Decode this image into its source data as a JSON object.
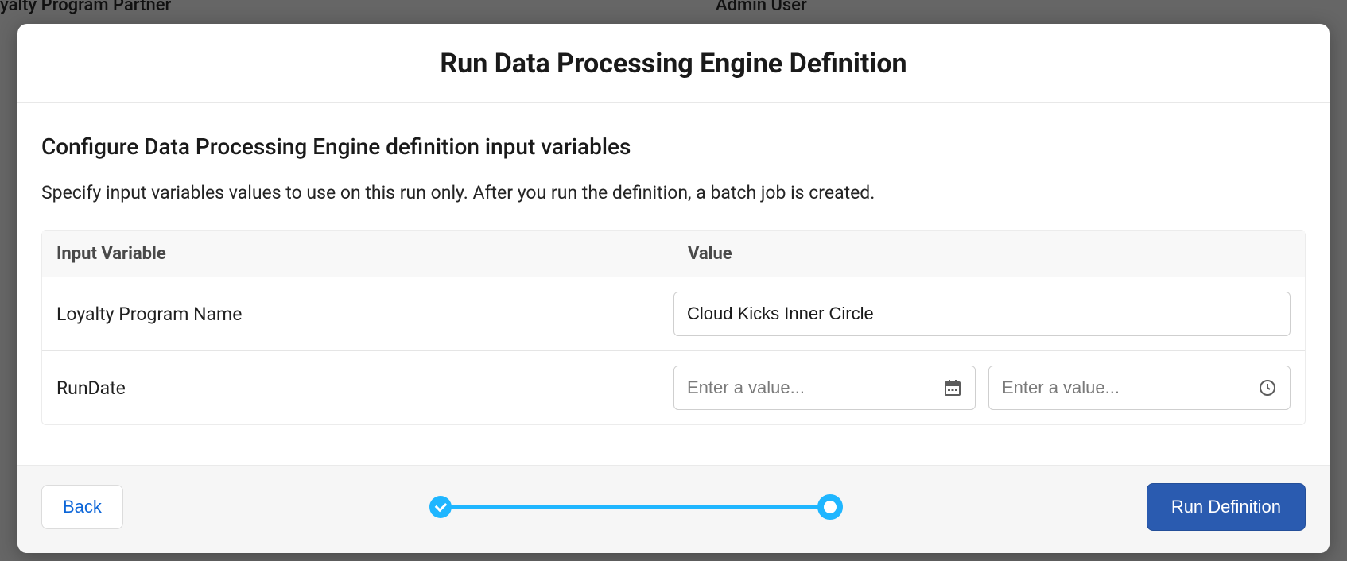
{
  "background": {
    "title_fragment": "yalty Program Partner",
    "user_label": "Admin User"
  },
  "modal": {
    "title": "Run Data Processing Engine Definition",
    "subtitle": "Configure Data Processing Engine definition input variables",
    "description": "Specify input variables values to use on this run only. After you run the definition, a batch job is created.",
    "table": {
      "header_var": "Input Variable",
      "header_val": "Value",
      "rows": [
        {
          "label": "Loyalty Program Name",
          "value": "Cloud Kicks Inner Circle",
          "type": "text"
        },
        {
          "label": "RunDate",
          "date_value": "",
          "date_placeholder": "Enter a value...",
          "time_value": "",
          "time_placeholder": "Enter a value...",
          "type": "datetime"
        }
      ]
    },
    "footer": {
      "back_label": "Back",
      "run_label": "Run Definition"
    }
  }
}
